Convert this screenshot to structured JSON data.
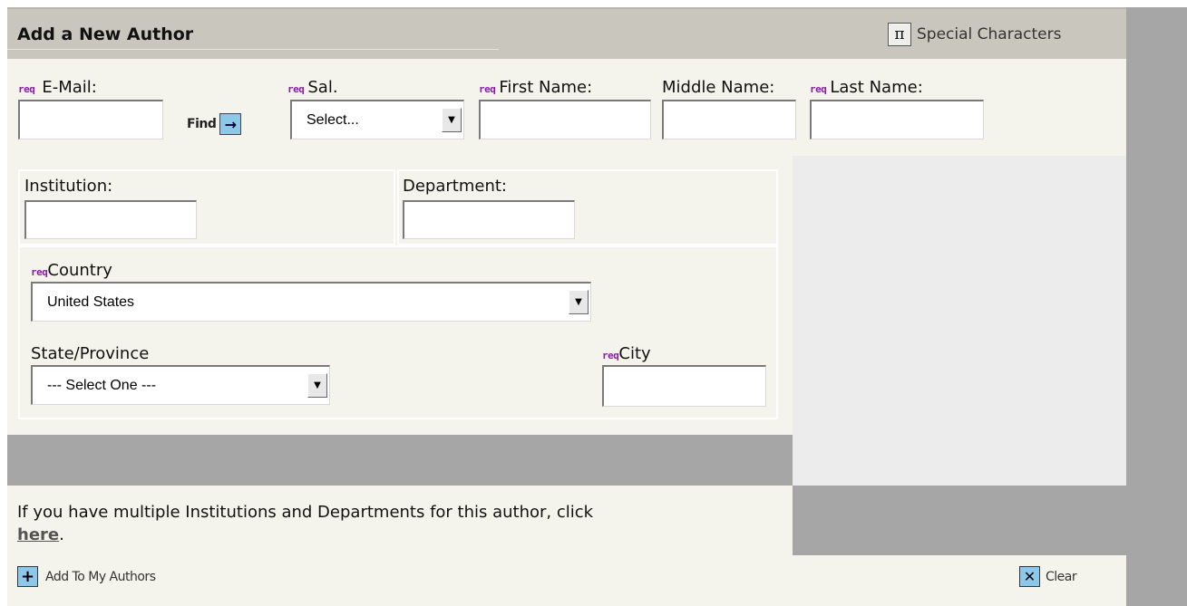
{
  "header": {
    "title": "Add a New Author",
    "special_characters_label": "Special Characters",
    "pi_glyph": "π"
  },
  "req_tag": "req",
  "fields": {
    "email": {
      "label": "E-Mail:",
      "value": ""
    },
    "find_label": "Find",
    "salutation": {
      "label": "Sal.",
      "selected": "Select..."
    },
    "first_name": {
      "label": "First Name:",
      "value": ""
    },
    "middle_name": {
      "label": "Middle Name:",
      "value": ""
    },
    "last_name": {
      "label": "Last Name:",
      "value": ""
    },
    "institution": {
      "label": "Institution:",
      "value": ""
    },
    "department": {
      "label": "Department:",
      "value": ""
    },
    "country": {
      "label": "Country",
      "selected": "United States"
    },
    "state": {
      "label": "State/Province",
      "selected": "--- Select One ---"
    },
    "city": {
      "label": "City",
      "value": ""
    }
  },
  "info": {
    "text": "If you have multiple Institutions and Departments for this author, click ",
    "link": "here",
    "suffix": "."
  },
  "footer": {
    "add_label": "Add To My Authors",
    "clear_label": "Clear"
  },
  "colors": {
    "header_bg": "#c9c7bd",
    "panel_bg": "#f5f4ec",
    "gray_band": "#a6a6a6",
    "req_color": "#8a1aa8",
    "icon_blue": "#8ec8e8"
  }
}
